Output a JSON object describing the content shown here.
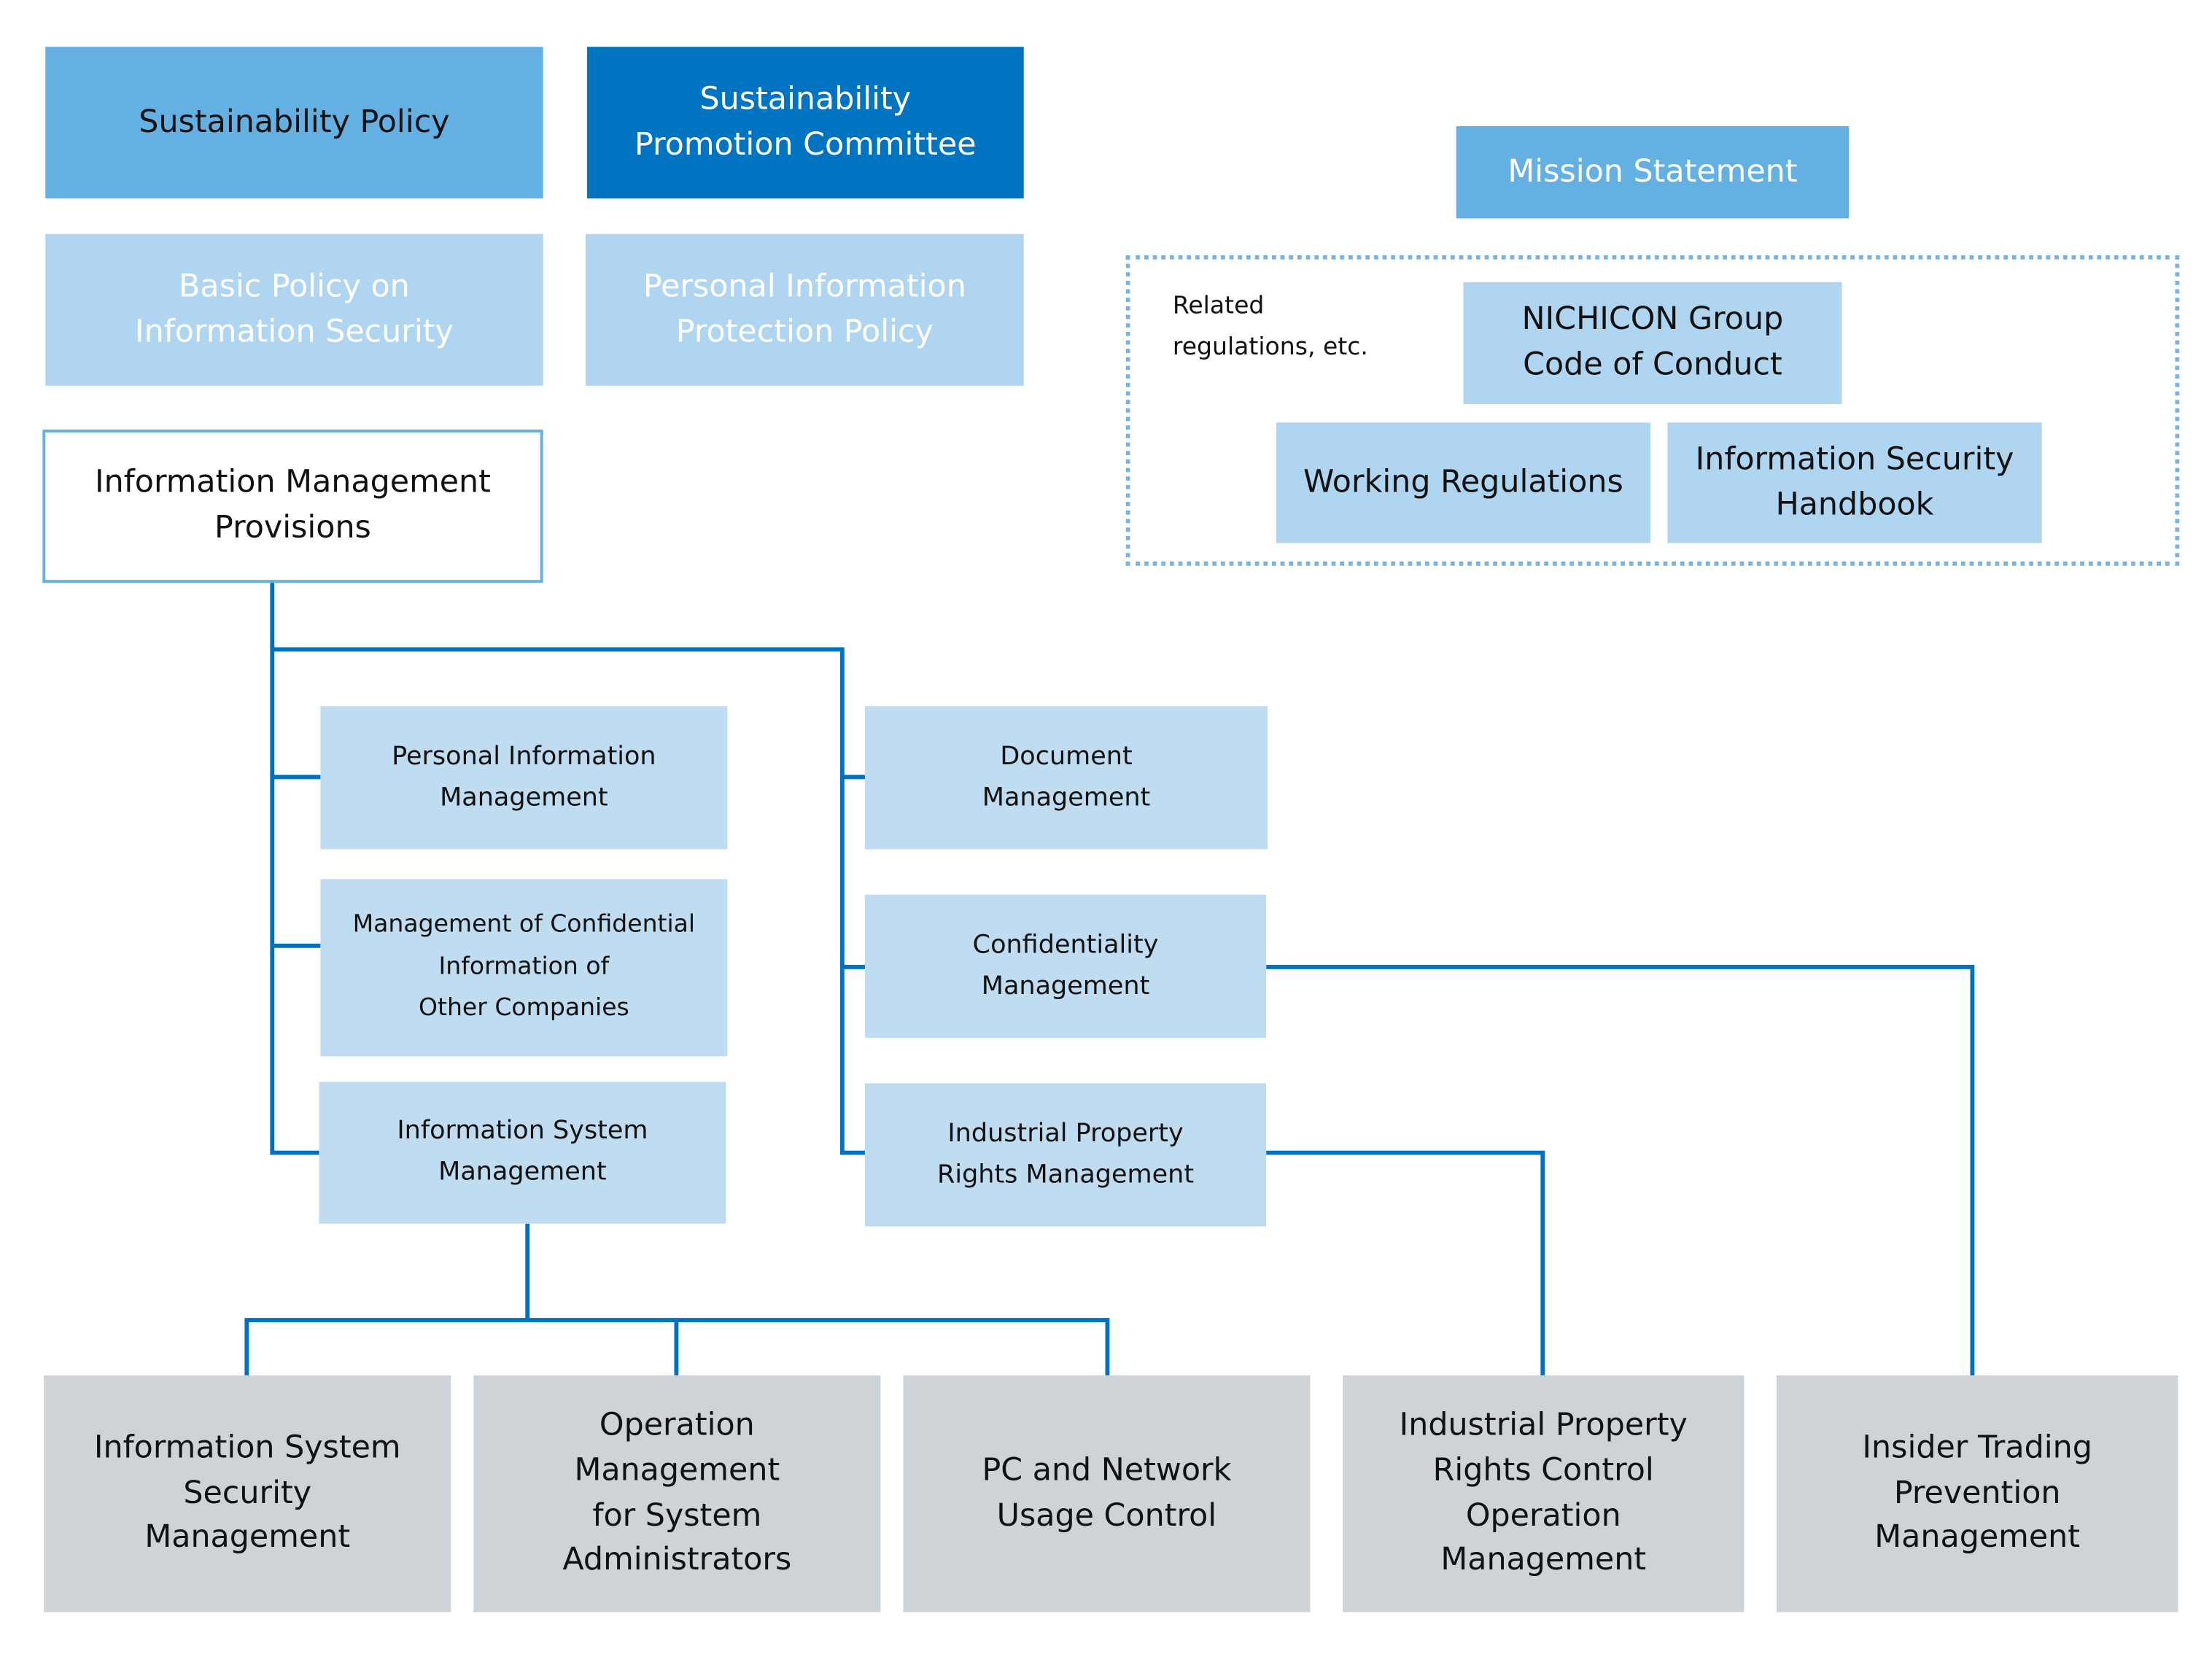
{
  "colors": {
    "primary": "#0074c1",
    "medium": "#64b0e3",
    "light": "#b0d5f1",
    "mid_box": "#bfdcf1",
    "gray_box": "#cdd3d6",
    "connector": "#0070c0",
    "dotted_border": "#7ab4de"
  },
  "top": {
    "sustainability_policy": "Sustainability Policy",
    "promotion_committee": "Sustainability\nPromotion Committee",
    "basic_policy": "Basic Policy on\nInformation Security",
    "personal_info_policy": "Personal Information\nProtection Policy",
    "provisions": "Information Management\nProvisions"
  },
  "related": {
    "mission_statement": "Mission Statement",
    "label": "Related\nregulations, etc.",
    "code_of_conduct": "NICHICON Group\nCode of Conduct",
    "working_regulations": "Working Regulations",
    "handbook": "Information Security\nHandbook"
  },
  "middle": {
    "personal_info_mgmt": "Personal Information\nManagement",
    "confidential_other": "Management of Confidential\nInformation of\nOther Companies",
    "info_system_mgmt": "Information System\nManagement",
    "document_mgmt": "Document\nManagement",
    "confidentiality_mgmt": "Confidentiality\nManagement",
    "industrial_property_mgmt": "Industrial Property\nRights Management"
  },
  "bottom": {
    "system_security": "Information System\nSecurity\nManagement",
    "operation_admin": "Operation\nManagement\nfor System\nAdministrators",
    "pc_network": "PC and Network\nUsage Control",
    "ip_control": "Industrial Property\nRights Control\nOperation\nManagement",
    "insider_trading": "Insider Trading\nPrevention\nManagement"
  }
}
